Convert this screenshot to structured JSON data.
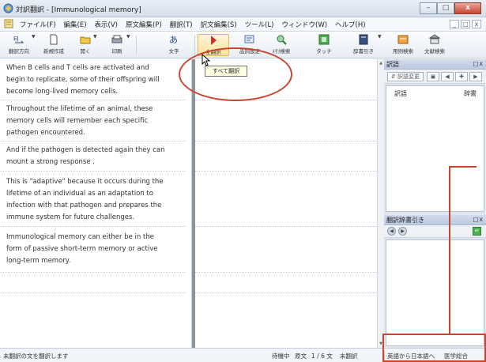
{
  "window": {
    "title": "対訳翻訳 - [Immunological memory]",
    "controls": [
      "–",
      "□",
      "x"
    ]
  },
  "menubar": {
    "items": [
      "ファイル(F)",
      "編集(E)",
      "表示(V)",
      "原文編集(P)",
      "翻訳(T)",
      "訳文編集(S)",
      "ツール(L)",
      "ウィンドウ(W)",
      "ヘルプ(H)"
    ],
    "mdi_controls": [
      "_",
      "□",
      "x"
    ]
  },
  "toolbar": {
    "buttons": [
      {
        "label": "翻訳方向",
        "icon": "translation-direction-icon"
      },
      {
        "label": "新規作成",
        "icon": "new-document-icon"
      },
      {
        "label": "開く",
        "icon": "open-folder-icon"
      },
      {
        "label": "印刷",
        "icon": "print-icon"
      },
      {
        "label": "文字",
        "icon": "text-format-icon"
      },
      {
        "label": "全翻訳",
        "icon": "translate-all-icon"
      },
      {
        "label": "品詞設定",
        "icon": "part-of-speech-icon"
      },
      {
        "label": "ﾒﾓﾘ検索",
        "icon": "memory-search-icon"
      },
      {
        "label": "タッチ",
        "icon": "touch-icon"
      },
      {
        "label": "辞書引き",
        "icon": "dictionary-lookup-icon"
      },
      {
        "label": "用例検索",
        "icon": "example-search-icon"
      },
      {
        "label": "文献検索",
        "icon": "document-search-icon"
      }
    ],
    "tooltip": "すべて翻訳"
  },
  "source_segments": [
    "When B cells and T cells are activated and begin to replicate, some of their offspring will become long-lived memory cells.",
    "Throughout the lifetime of an animal, these memory cells will remember each specific pathogen encountered.",
    "And if the pathogen is detected again they can mount a strong response .",
    "This is \"adaptive\" because it occurs during the lifetime of an individual as an adaptation to infection with that pathogen and prepares the immune system for future challenges.",
    "Immunological memory can either be in the form of passive short-term memory or active long-term memory."
  ],
  "source_lines": [
    [
      "When B cells and T cells are activated and",
      "begin to replicate, some of their offspring will",
      "become long-lived memory cells."
    ],
    [
      "Throughout the lifetime of an animal, these",
      "memory cells will remember each specific",
      "pathogen encountered."
    ],
    [
      "And if the pathogen is detected again they can",
      "mount a strong response ."
    ],
    [
      "This is \"adaptive\" because it occurs during the",
      "lifetime of an individual as an adaptation to",
      "infection with that pathogen and prepares the",
      "immune system for future challenges."
    ],
    [
      "Immunological memory can either be in the",
      "form of passive short-term memory or active",
      "long-term memory."
    ]
  ],
  "side_panel_top": {
    "title": "訳語",
    "controls": "□x",
    "tool_label": "訳語変更",
    "col_word": "訳語",
    "col_dict": "辞書"
  },
  "side_panel_bottom": {
    "title": "翻訳辞書引き",
    "controls": "□x"
  },
  "statusbar": {
    "message": "未翻訳の文を翻訳します",
    "state": "待機中",
    "mode": "原文",
    "position": "1 / 6 文",
    "untranslated": "未翻訳",
    "direction": "英語から日本語へ",
    "domain": "医学総合"
  },
  "colors": {
    "annotation": "#c8452e",
    "accent": "#d9534f"
  }
}
